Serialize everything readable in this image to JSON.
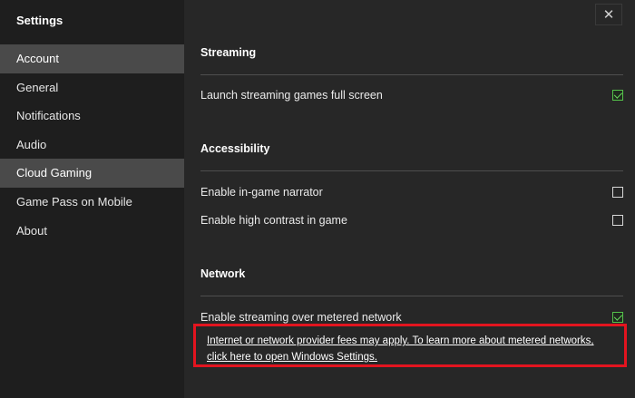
{
  "sidebar": {
    "title": "Settings",
    "items": [
      {
        "label": "Account",
        "selected": true
      },
      {
        "label": "General",
        "selected": false
      },
      {
        "label": "Notifications",
        "selected": false
      },
      {
        "label": "Audio",
        "selected": false
      },
      {
        "label": "Cloud Gaming",
        "selected": true
      },
      {
        "label": "Game Pass on Mobile",
        "selected": false
      },
      {
        "label": "About",
        "selected": false
      }
    ]
  },
  "window": {
    "close_glyph": "✕"
  },
  "sections": {
    "streaming": {
      "title": "Streaming",
      "rows": [
        {
          "label": "Launch streaming games full screen",
          "checked": true
        }
      ]
    },
    "accessibility": {
      "title": "Accessibility",
      "rows": [
        {
          "label": "Enable in-game narrator",
          "checked": false
        },
        {
          "label": "Enable high contrast in game",
          "checked": false
        }
      ]
    },
    "network": {
      "title": "Network",
      "rows": [
        {
          "label": "Enable streaming over metered network",
          "checked": true
        }
      ],
      "note": "Internet or network provider fees may apply. To learn more about metered networks, click here to open Windows Settings."
    }
  },
  "colors": {
    "sidebar_bg": "#1e1e1e",
    "main_bg": "#272727",
    "selected_item_bg": "#4a4a4a",
    "check_green": "#54c24a",
    "highlight_red": "#e3141f"
  }
}
